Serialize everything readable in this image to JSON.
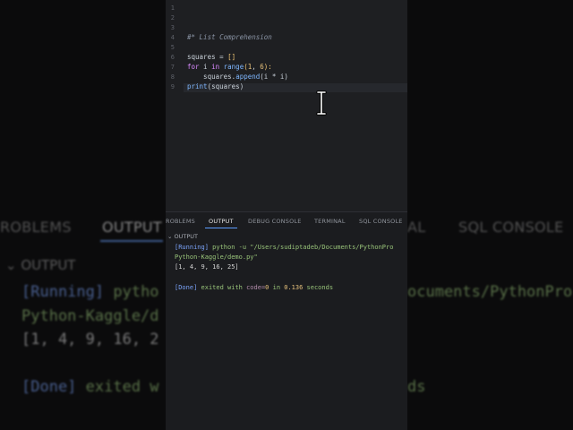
{
  "editor": {
    "line_numbers": [
      "1",
      "2",
      "3",
      "4",
      "5",
      "6",
      "7",
      "8",
      "9"
    ],
    "comment": "#* List Comprehension",
    "code": {
      "l6": {
        "a": "squares = ",
        "b": "[]"
      },
      "l7": {
        "kw1": "for",
        "a": " i ",
        "kw2": "in",
        "fn": " range",
        "b": "(",
        "n1": "1",
        "c": ", ",
        "n2": "6",
        "d": "):"
      },
      "l8": {
        "a": "    squares.",
        "fn": "append",
        "b": "(i * i)"
      },
      "l9": {
        "fn": "print",
        "b": "(squares)"
      }
    }
  },
  "panel": {
    "tabs": [
      "ROBLEMS",
      "OUTPUT",
      "DEBUG CONSOLE",
      "TERMINAL",
      "SQL CONSOLE"
    ],
    "active_tab": "OUTPUT",
    "section_title": "OUTPUT",
    "output": {
      "running_tag": "[Running]",
      "command": " python -u \"/Users/sudiptadeb/Documents/PythonPro",
      "command_cont": "Python-Kaggle/demo.py\"",
      "result": "[1, 4, 9, 16, 25]",
      "done_tag": "[Done]",
      "done_text": " exited with ",
      "code_label": "code=",
      "code_value": "0",
      "in_text": " in ",
      "time_value": "0.136",
      "seconds_text": " seconds"
    }
  },
  "background": {
    "tabs": [
      "ROBLEMS",
      "OUTPUT",
      "AL",
      "SQL CONSOLE"
    ],
    "head": "⌄ OUTPUT",
    "line1a": "[Running]",
    "line1b": " pytho",
    "line1c": "ocuments/PythonPro",
    "line2": "Python-Kaggle/d",
    "line3": "[1, 4, 9, 16, 2",
    "line4a": "[Done]",
    "line4b": " exited w",
    "line4c": "ds"
  },
  "colors": {
    "accent": "#5c9cff",
    "editor_bg": "#1e1f22",
    "panel_bg": "#1b1c1f"
  }
}
